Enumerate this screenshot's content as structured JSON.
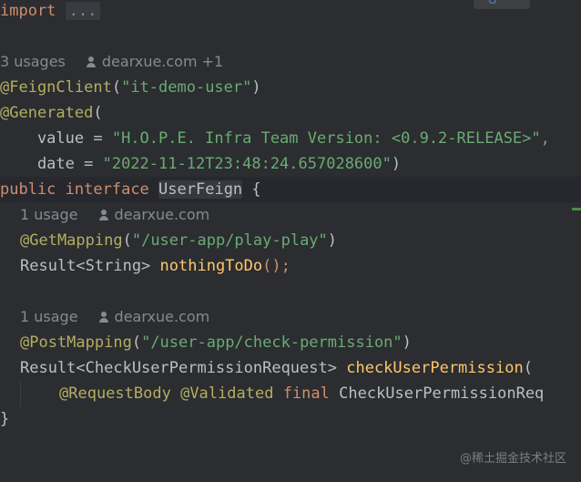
{
  "editor": {
    "import_keyword": "import",
    "import_fold": "...",
    "class_usages": "3 usages",
    "class_author": "dearxue.com +1",
    "feign_annotation": "@FeignClient",
    "feign_open": "(",
    "feign_value": "\"it-demo-user\"",
    "feign_close": ")",
    "generated_annotation": "@Generated",
    "generated_open": "(",
    "value_attr": "    value = ",
    "value_str": "\"H.O.P.E. Infra Team Version: <0.9.2-RELEASE>\",",
    "date_attr": "    date = ",
    "date_str": "\"2022-11-12T23:48:24.657028600\"",
    "date_close": ")",
    "kw_public": "public",
    "kw_interface": "interface",
    "class_name": "UserFeign",
    "class_open": " {",
    "m1_usages": "1 usage",
    "m1_author": "dearxue.com",
    "m1_annotation": "@GetMapping",
    "m1_open": "(",
    "m1_path": "\"/user-app/play-play\"",
    "m1_close": ")",
    "m1_return": "Result<String> ",
    "m1_name": "nothingToDo",
    "m1_parens": "();",
    "m2_usages": "1 usage",
    "m2_author": "dearxue.com",
    "m2_annotation": "@PostMapping",
    "m2_open": "(",
    "m2_path": "\"/user-app/check-permission\"",
    "m2_close": ")",
    "m2_return": "Result<CheckUserPermissionRequest> ",
    "m2_name": "checkUserPermission",
    "m2_paren": "(",
    "p_request_body": "@RequestBody",
    "p_validated": "@Validated",
    "p_final": "final",
    "p_type": "CheckUserPermissionReq",
    "closing_brace": "}"
  },
  "popup_glyph": "G",
  "watermark": "@稀土掘金技术社区",
  "icons": {
    "author": "user-icon"
  },
  "colors": {
    "background": "#2b2d30",
    "keyword": "#cf8e6d",
    "annotation": "#b3ae60",
    "string": "#6aab73",
    "method": "#ffc66d"
  }
}
